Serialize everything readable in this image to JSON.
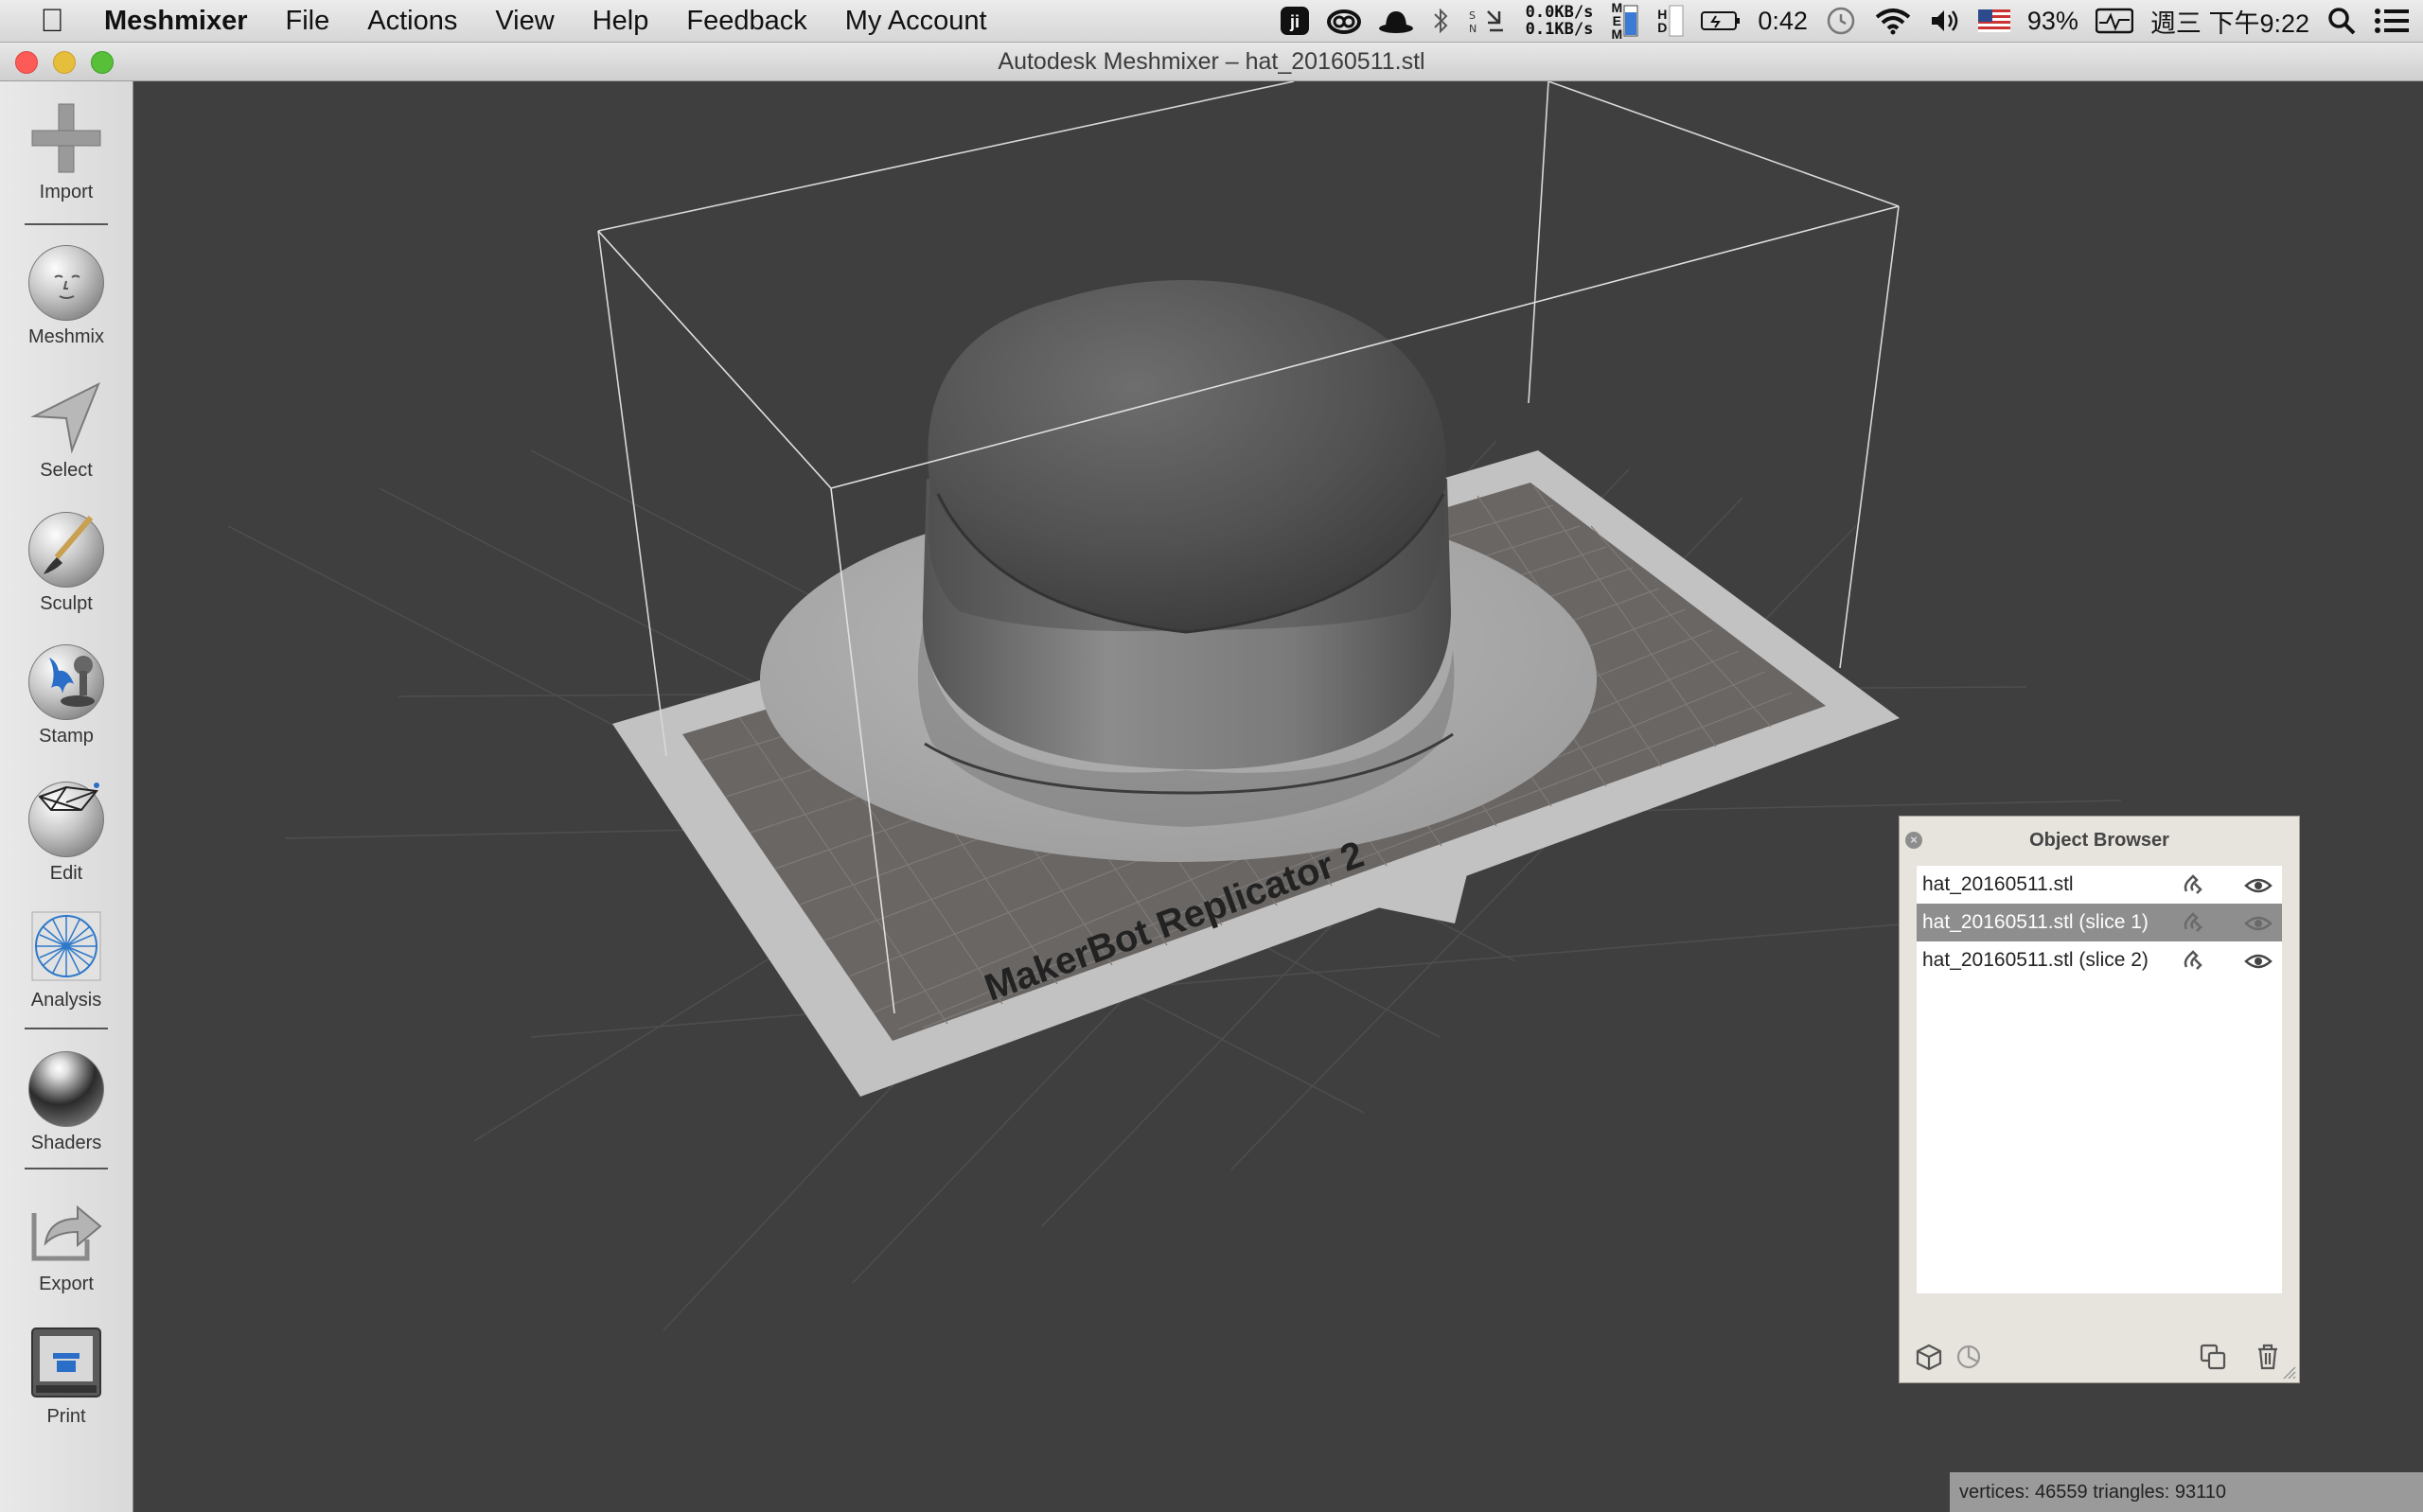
{
  "menubar": {
    "apple_icon": "apple-logo-icon",
    "app_name": "Meshmixer",
    "items": [
      "File",
      "Actions",
      "View",
      "Help",
      "Feedback",
      "My Account"
    ],
    "status": {
      "net_up": "0.0KB/s",
      "net_down": "0.1KB/s",
      "mem_label": "MEM",
      "hd_label": "HD",
      "battery_time": "0:42",
      "battery_percent": "93%",
      "datetime": "週三 下午9:22"
    }
  },
  "window": {
    "title": "Autodesk Meshmixer – hat_20160511.stl"
  },
  "toolbar": {
    "tools": [
      {
        "label": "Import",
        "icon": "import-plus-icon"
      },
      {
        "label": "Meshmix",
        "icon": "meshmix-face-icon"
      },
      {
        "label": "Select",
        "icon": "select-arrow-icon"
      },
      {
        "label": "Sculpt",
        "icon": "sculpt-brush-icon"
      },
      {
        "label": "Stamp",
        "icon": "stamp-icon"
      },
      {
        "label": "Edit",
        "icon": "edit-icon"
      },
      {
        "label": "Analysis",
        "icon": "analysis-icon"
      },
      {
        "label": "Shaders",
        "icon": "shaders-icon"
      },
      {
        "label": "Export",
        "icon": "export-icon"
      },
      {
        "label": "Print",
        "icon": "print-icon"
      }
    ]
  },
  "viewport": {
    "printer_label": "MakerBot Replicator 2",
    "stats": "vertices: 46559 triangles: 93110"
  },
  "object_browser": {
    "title": "Object Browser",
    "objects": [
      {
        "name": "hat_20160511.stl",
        "selected": false
      },
      {
        "name": "hat_20160511.stl (slice 1)",
        "selected": true
      },
      {
        "name": "hat_20160511.stl (slice 2)",
        "selected": false
      }
    ]
  },
  "colors": {
    "viewport_bg": "#3f3f3f",
    "selection": "#8e8e8e",
    "plate": "#c2c2c2"
  }
}
